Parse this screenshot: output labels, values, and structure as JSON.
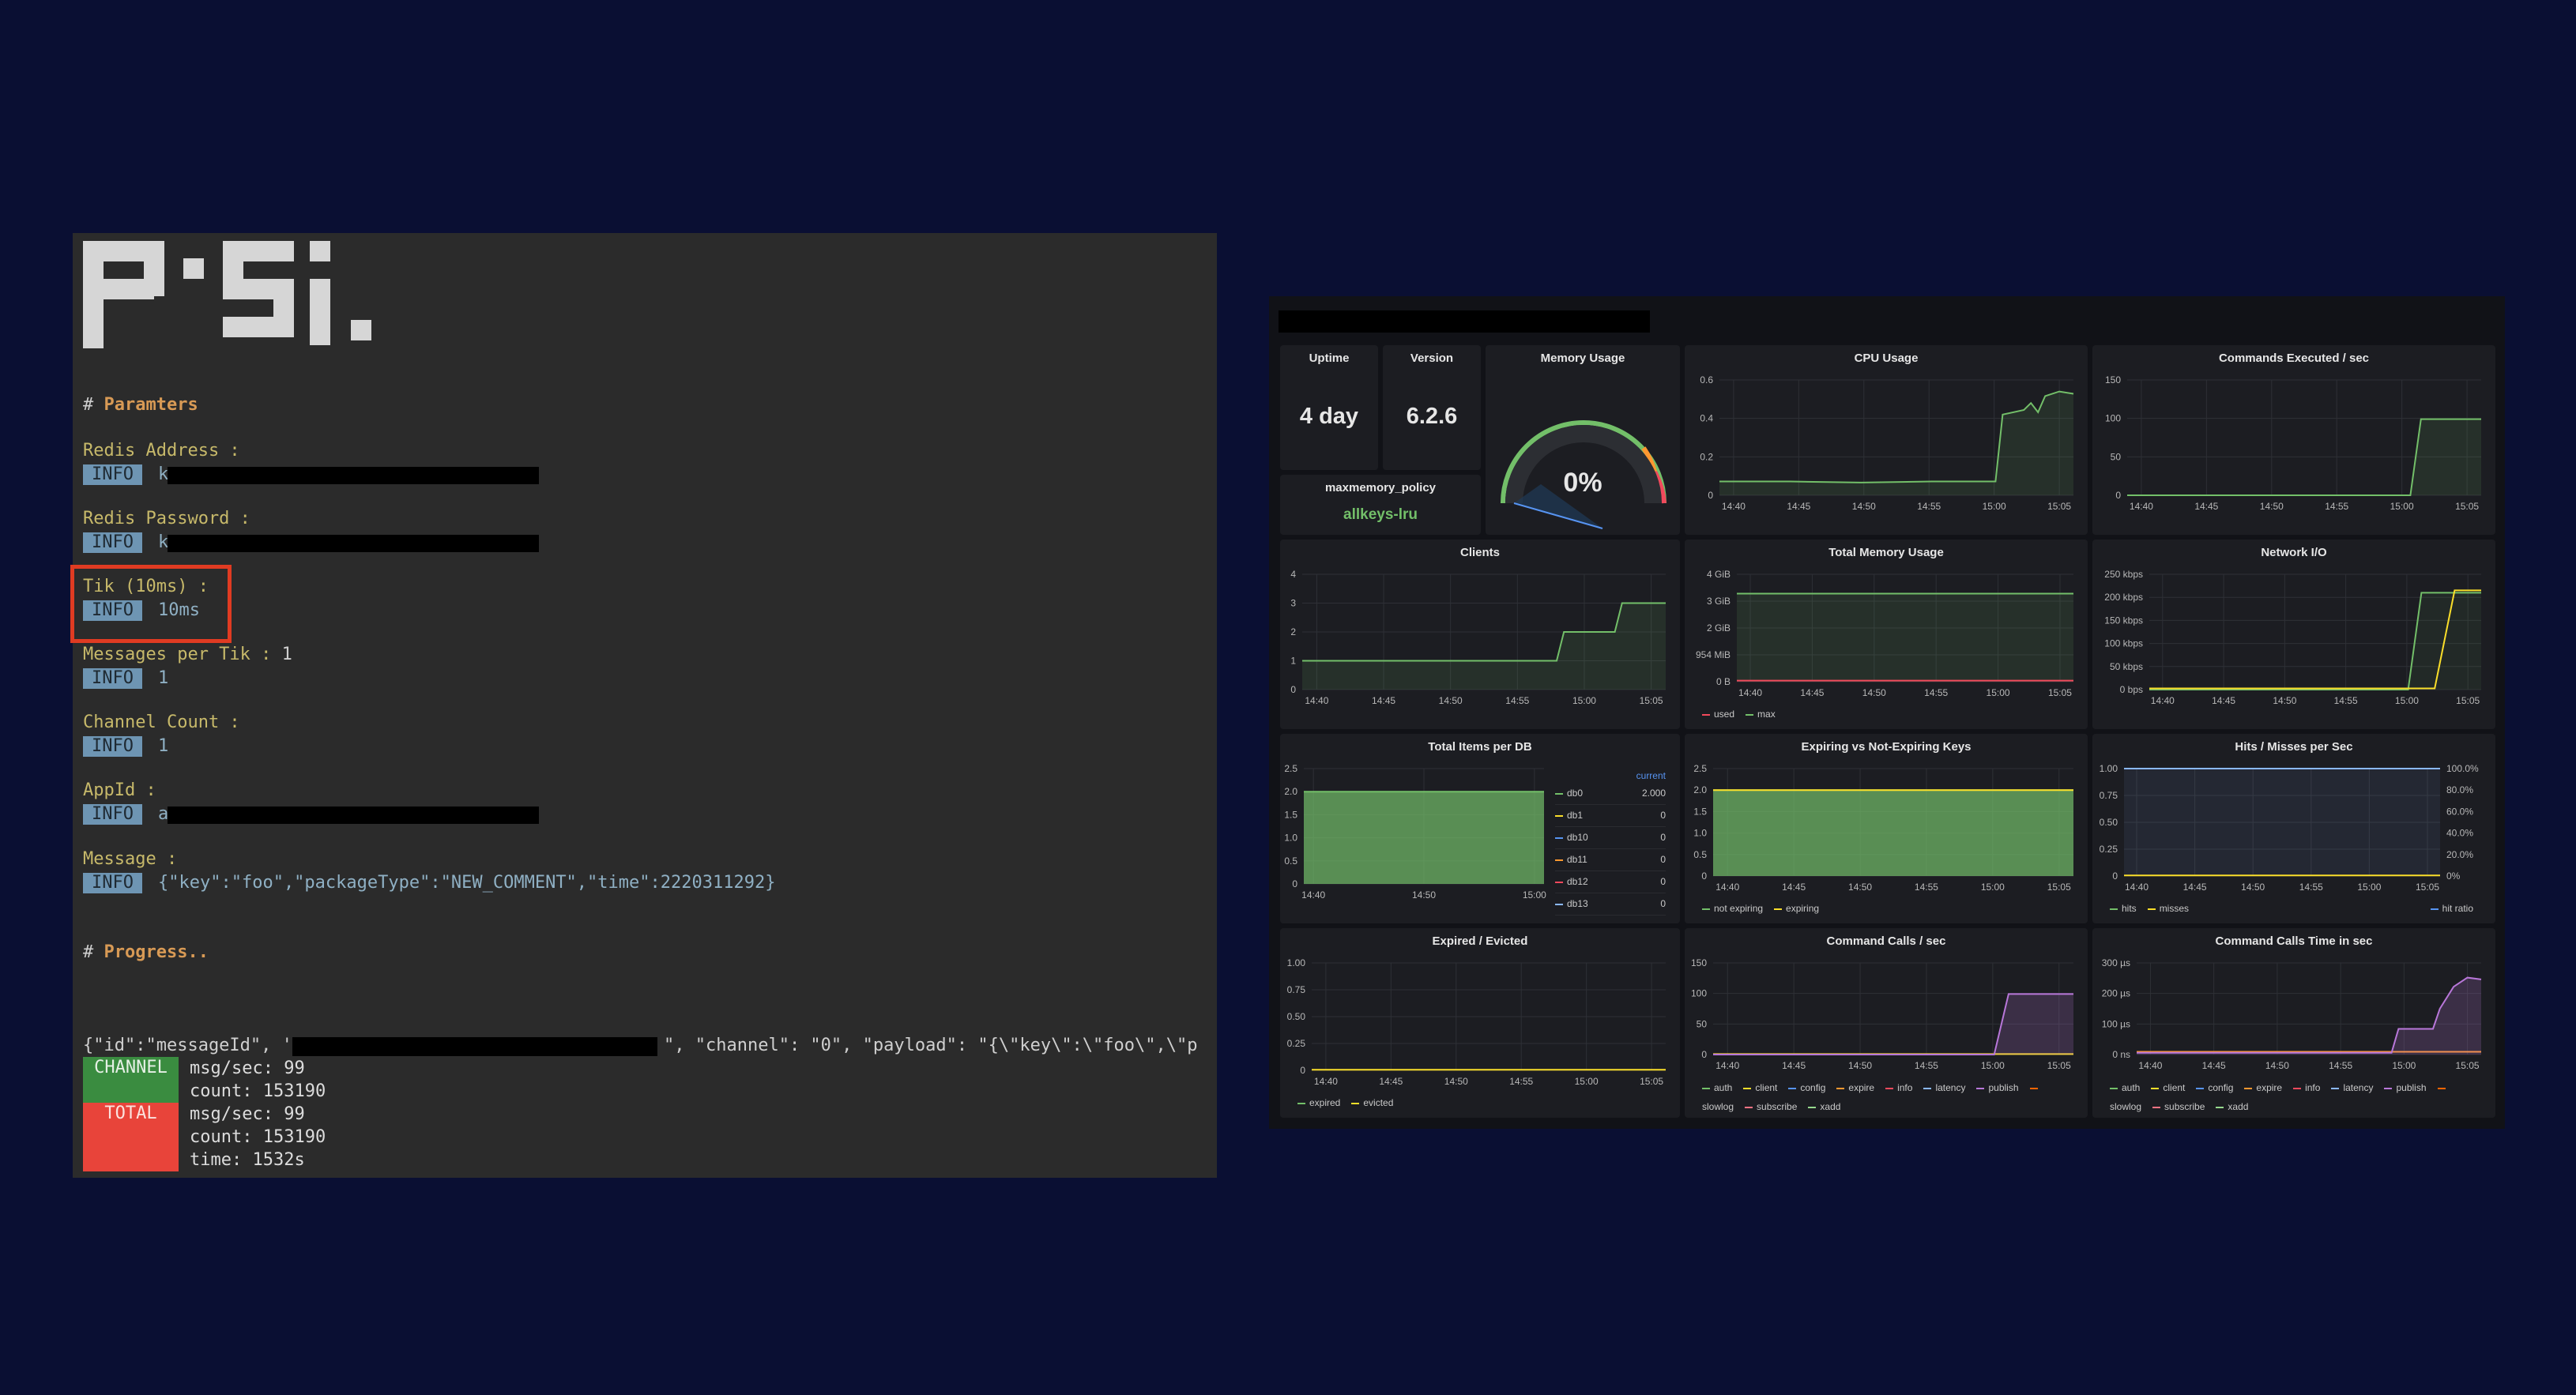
{
  "terminal": {
    "params_hash": "#",
    "params_header": "Paramters",
    "progress_hash": "#",
    "progress_header": "Progress..",
    "info_tag": "INFO",
    "fields": [
      {
        "label": "Redis Address :",
        "value": "k",
        "redacted": true
      },
      {
        "label": "Redis Password :",
        "value": "k",
        "redacted": true
      },
      {
        "label": "Tik (10ms) :",
        "value": "10ms",
        "redacted": false
      },
      {
        "label": "Messages per Tik :",
        "inline": "1",
        "value": "1",
        "redacted": false
      },
      {
        "label": "Channel Count :",
        "value": "1",
        "redacted": false
      },
      {
        "label": "AppId :",
        "value": "a",
        "redacted": true
      },
      {
        "label": "Message :",
        "value": "{\"key\":\"foo\",\"packageType\":\"NEW_COMMENT\",\"time\":2220311292}",
        "redacted": false
      }
    ],
    "log_prefix": "{\"id\":\"messageId\", '",
    "log_suffix": "\", \"channel\": \"0\", \"payload\": \"{\\\"key\\\":\\\"foo\\\",\\\"p",
    "channel_badge": "CHANNEL",
    "total_badge": "TOTAL",
    "channel_stats": [
      "msg/sec: 99",
      "count: 153190"
    ],
    "total_stats": [
      "msg/sec: 99",
      "count: 153190",
      "time: 1532s"
    ]
  },
  "dashboard": {
    "uptime": {
      "title": "Uptime",
      "value": "4 day"
    },
    "version": {
      "title": "Version",
      "value": "6.2.6"
    },
    "memory_usage": {
      "title": "Memory Usage",
      "value": "0%",
      "level": 0
    },
    "maxmemory": {
      "title": "maxmemory_policy",
      "value": "allkeys-lru"
    },
    "time_ticks": [
      "14:40",
      "14:45",
      "14:50",
      "14:55",
      "15:00",
      "15:05"
    ],
    "time_ticks_short": [
      "14:40",
      "14:50",
      "15:00"
    ],
    "colors": {
      "green": "#73bf69",
      "yellow": "#fade2a",
      "red": "#f2495c",
      "purple": "#b877d9",
      "orange": "#ff9830",
      "blue": "#5794f2",
      "cyan": "#8ab8ff"
    },
    "cpu": {
      "title": "CPU Usage",
      "y_ticks": [
        "0.6",
        "0.4",
        "0.2",
        "0"
      ]
    },
    "commands": {
      "title": "Commands Executed / sec",
      "y_ticks": [
        "150",
        "100",
        "50",
        "0"
      ]
    },
    "clients": {
      "title": "Clients",
      "y_ticks": [
        "4",
        "3",
        "2",
        "1",
        "0"
      ]
    },
    "total_memory": {
      "title": "Total Memory Usage",
      "y_ticks": [
        "4 GiB",
        "3 GiB",
        "2 GiB",
        "954 MiB",
        "0 B"
      ],
      "legend": [
        "used",
        "max"
      ]
    },
    "network": {
      "title": "Network I/O",
      "y_ticks": [
        "250 kbps",
        "200 kbps",
        "150 kbps",
        "100 kbps",
        "50 kbps",
        "0 bps"
      ]
    },
    "items_db": {
      "title": "Total Items per DB",
      "y_ticks": [
        "2.5",
        "2.0",
        "1.5",
        "1.0",
        "0.5",
        "0"
      ],
      "header": "current",
      "rows": [
        {
          "name": "db0",
          "value": "2.000"
        },
        {
          "name": "db1",
          "value": "0"
        },
        {
          "name": "db10",
          "value": "0"
        },
        {
          "name": "db11",
          "value": "0"
        },
        {
          "name": "db12",
          "value": "0"
        },
        {
          "name": "db13",
          "value": "0"
        }
      ]
    },
    "expiring": {
      "title": "Expiring vs Not-Expiring Keys",
      "y_ticks": [
        "2.5",
        "2.0",
        "1.5",
        "1.0",
        "0.5",
        "0"
      ],
      "legend": [
        "not expiring",
        "expiring"
      ]
    },
    "hits": {
      "title": "Hits / Misses per Sec",
      "y_ticks": [
        "1.00",
        "0.75",
        "0.50",
        "0.25",
        "0"
      ],
      "y2_ticks": [
        "100.0%",
        "80.0%",
        "60.0%",
        "40.0%",
        "20.0%",
        "0%"
      ],
      "legend": [
        "hits",
        "misses"
      ],
      "legend_right": "hit ratio"
    },
    "expired": {
      "title": "Expired / Evicted",
      "y_ticks": [
        "1.00",
        "0.75",
        "0.50",
        "0.25",
        "0"
      ],
      "legend": [
        "expired",
        "evicted"
      ]
    },
    "calls": {
      "title": "Command Calls / sec",
      "y_ticks": [
        "150",
        "100",
        "50",
        "0"
      ],
      "legend": [
        "auth",
        "client",
        "config",
        "expire",
        "info",
        "latency",
        "publish",
        "slowlog",
        "subscribe",
        "xadd"
      ]
    },
    "calls_time": {
      "title": "Command Calls Time in sec",
      "y_ticks": [
        "300 µs",
        "200 µs",
        "100 µs",
        "0 ns"
      ],
      "legend": [
        "auth",
        "client",
        "config",
        "expire",
        "info",
        "latency",
        "publish",
        "slowlog",
        "subscribe",
        "xadd"
      ]
    }
  }
}
